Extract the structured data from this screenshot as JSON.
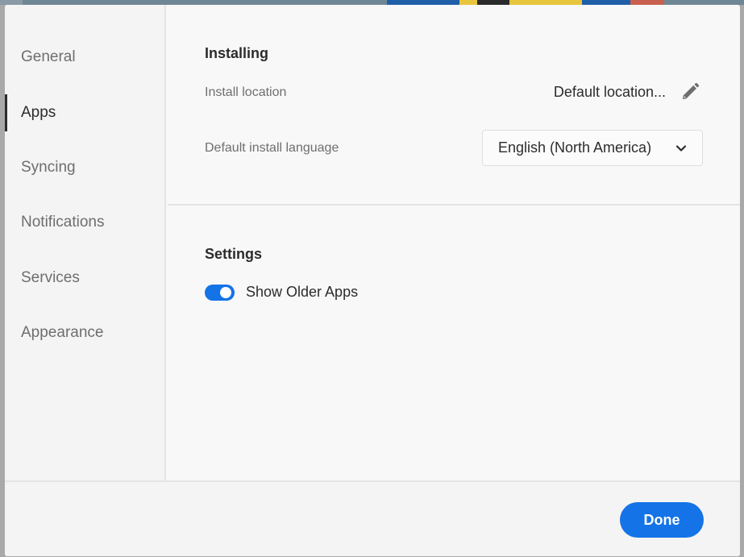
{
  "sidebar": {
    "items": [
      {
        "label": "General",
        "selected": false
      },
      {
        "label": "Apps",
        "selected": true
      },
      {
        "label": "Syncing",
        "selected": false
      },
      {
        "label": "Notifications",
        "selected": false
      },
      {
        "label": "Services",
        "selected": false
      },
      {
        "label": "Appearance",
        "selected": false
      }
    ]
  },
  "installing": {
    "title": "Installing",
    "install_location_label": "Install location",
    "install_location_value": "Default location...",
    "language_label": "Default install language",
    "language_value": "English (North America)"
  },
  "settings": {
    "title": "Settings",
    "show_older_apps_label": "Show Older Apps",
    "show_older_apps_on": true
  },
  "footer": {
    "done_label": "Done"
  },
  "colors": {
    "accent": "#1473e6",
    "text_primary": "#2c2c2c",
    "text_secondary": "#6e6e6e",
    "background": "#f8f8f8"
  },
  "icons": {
    "edit": "pencil-icon",
    "dropdown": "chevron-down-icon"
  }
}
